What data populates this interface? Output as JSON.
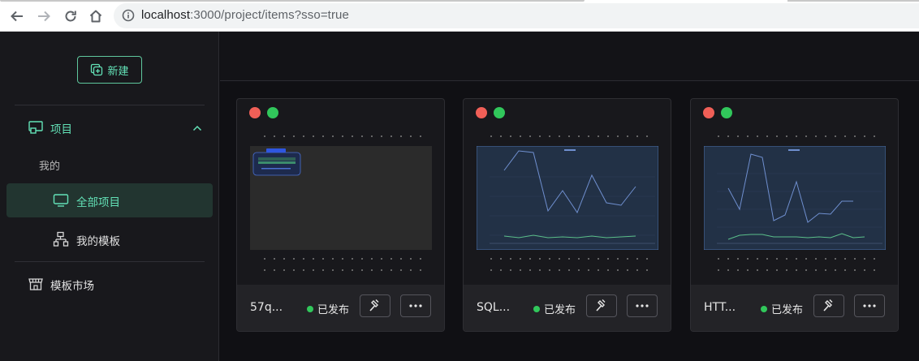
{
  "browser": {
    "url_host": "localhost",
    "url_path": ":3000/project/items?sso=true"
  },
  "sidebar": {
    "new_button": "新建",
    "project_group": "项目",
    "mine_label": "我的",
    "all_projects": "全部项目",
    "my_templates": "我的模板",
    "template_market": "模板市场"
  },
  "cards": [
    {
      "title": "57q...",
      "status": "已发布"
    },
    {
      "title": "SQL...",
      "status": "已发布"
    },
    {
      "title": "HTT...",
      "status": "已发布"
    }
  ],
  "colors": {
    "accent": "#63e2b7",
    "published": "#31c75b",
    "close_dot": "#f05f57",
    "open_dot": "#31c75b"
  }
}
